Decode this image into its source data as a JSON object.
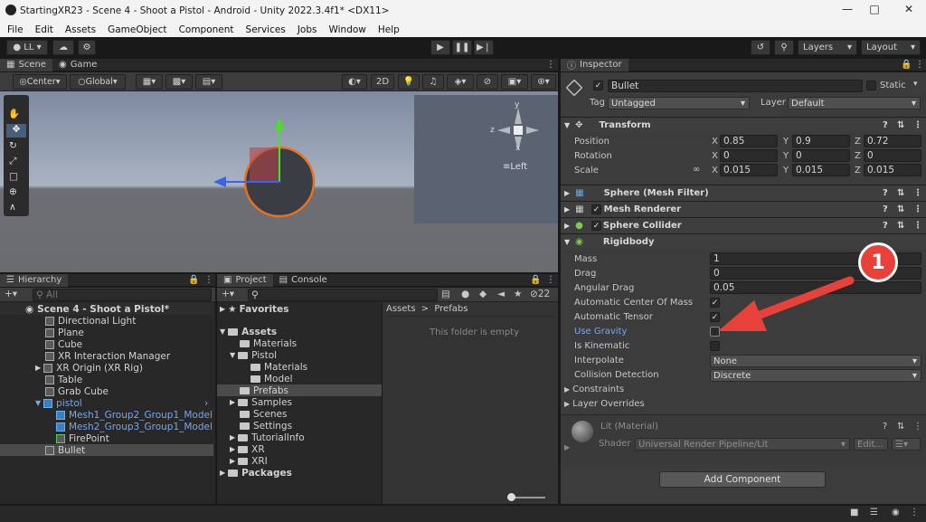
{
  "window": {
    "title": "StartingXR23 - Scene 4 - Shoot a Pistol - Android - Unity 2022.3.4f1* <DX11>"
  },
  "menu": [
    "File",
    "Edit",
    "Assets",
    "GameObject",
    "Component",
    "Services",
    "Jobs",
    "Window",
    "Help"
  ],
  "toolbar": {
    "account": "LL",
    "layers": "Layers",
    "layout": "Layout"
  },
  "scene": {
    "tab_scene": "Scene",
    "tab_game": "Game",
    "pivot": "Center",
    "space": "Global",
    "mode2d": "2D",
    "gizmo_view": "Left",
    "axis_x": "x",
    "axis_y": "y",
    "axis_z": "z"
  },
  "hierarchy": {
    "tab": "Hierarchy",
    "search_placeholder": "All",
    "scene_name": "Scene 4 - Shoot a Pistol*",
    "items": [
      "Directional Light",
      "Plane",
      "Cube",
      "XR Interaction Manager",
      "XR Origin (XR Rig)",
      "Table",
      "Grab Cube",
      "pistol",
      "Mesh1_Group2_Group1_Model",
      "Mesh2_Group3_Group1_Model",
      "FirePoint",
      "Bullet"
    ]
  },
  "project": {
    "tab_project": "Project",
    "tab_console": "Console",
    "favorites": "Favorites",
    "hidden_count": "22",
    "tree": [
      "Assets",
      "Materials",
      "Pistol",
      "Materials",
      "Model",
      "Prefabs",
      "Samples",
      "Scenes",
      "Settings",
      "TutorialInfo",
      "XR",
      "XRI",
      "Packages"
    ],
    "breadcrumb_root": "Assets",
    "breadcrumb_sep": ">",
    "breadcrumb_leaf": "Prefabs",
    "empty_msg": "This folder is empty"
  },
  "inspector": {
    "tab": "Inspector",
    "object_name": "Bullet",
    "static_label": "Static",
    "tag_label": "Tag",
    "tag_value": "Untagged",
    "layer_label": "Layer",
    "layer_value": "Default",
    "transform": {
      "title": "Transform",
      "position": "Position",
      "rotation": "Rotation",
      "scale": "Scale",
      "pos": [
        "0.85",
        "0.9",
        "0.72"
      ],
      "rot": [
        "0",
        "0",
        "0"
      ],
      "scl": [
        "0.015",
        "0.015",
        "0.015"
      ],
      "ax": [
        "X",
        "Y",
        "Z"
      ]
    },
    "components": [
      "Sphere (Mesh Filter)",
      "Mesh Renderer",
      "Sphere Collider",
      "Rigidbody"
    ],
    "rigidbody": {
      "mass_label": "Mass",
      "mass": "1",
      "drag_label": "Drag",
      "drag": "0",
      "angular_drag_label": "Angular Drag",
      "angular_drag": "0.05",
      "auto_com": "Automatic Center Of Mass",
      "auto_tensor": "Automatic Tensor",
      "use_gravity": "Use Gravity",
      "is_kinematic": "Is Kinematic",
      "interpolate_label": "Interpolate",
      "interpolate": "None",
      "collision_label": "Collision Detection",
      "collision": "Discrete",
      "constraints": "Constraints",
      "layer_overrides": "Layer Overrides"
    },
    "material": {
      "name": "Lit (Material)",
      "shader_label": "Shader",
      "shader": "Universal Render Pipeline/Lit",
      "edit": "Edit..."
    },
    "add_component": "Add Component"
  },
  "annotation": {
    "number": "1"
  },
  "colors": {
    "accent_arrow": "#e8413a",
    "selection": "#2c5d87",
    "link_blue": "#7aa6e6"
  }
}
